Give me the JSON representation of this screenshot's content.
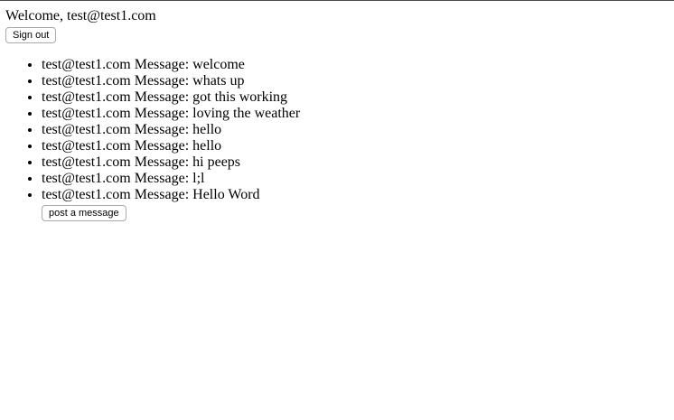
{
  "header": {
    "welcome_text": "Welcome, test@test1.com",
    "sign_out_label": "Sign out"
  },
  "messages": [
    {
      "text": "test@test1.com Message: welcome"
    },
    {
      "text": "test@test1.com Message: whats up"
    },
    {
      "text": "test@test1.com Message: got this working"
    },
    {
      "text": "test@test1.com Message: loving the weather"
    },
    {
      "text": "test@test1.com Message: hello"
    },
    {
      "text": "test@test1.com Message: hello"
    },
    {
      "text": "test@test1.com Message: hi peeps"
    },
    {
      "text": "test@test1.com Message: l;l"
    },
    {
      "text": "test@test1.com Message: Hello Word"
    }
  ],
  "actions": {
    "post_label": "post a message"
  }
}
